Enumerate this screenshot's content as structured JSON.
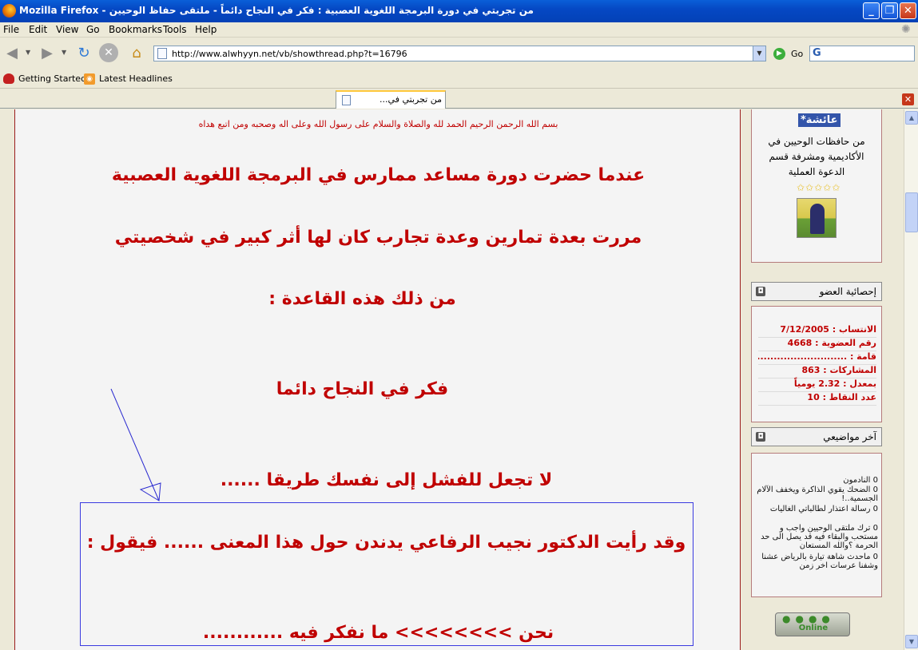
{
  "window": {
    "title": "من تجربتي في دورة البرمجة اللغوية العصبية : فكر في النجاح دائماً - ملتقى حفاظ الوحيين - Mozilla Firefox",
    "min_label": "_",
    "max_label": "❐",
    "close_label": "✕"
  },
  "menu": {
    "file": "File",
    "edit": "Edit",
    "view": "View",
    "go": "Go",
    "bookmarks": "Bookmarks",
    "tools": "Tools",
    "help": "Help"
  },
  "nav": {
    "back_icon": "◀",
    "forward_icon": "▶",
    "reload_icon": "↻",
    "stop_icon": "✕",
    "home_icon": "⌂",
    "url": "http://www.alwhyyn.net/vb/showthread.php?t=16796",
    "go_label": "Go",
    "search_icon": "G"
  },
  "bookmarks": {
    "item1": "Getting Started",
    "item2": "Latest Headlines"
  },
  "tabs": {
    "tab1_label": "من تجربتي في..."
  },
  "post": {
    "bismillah": "بسم الله الرحمن الرحيم الحمد لله والصلاة والسلام على رسول الله وعلى اله وصحبه ومن اتبع هداه",
    "line1": "عندما حضرت دورة مساعد ممارس في البرمجة اللغوية العصبية",
    "line2": "مررت بعدة تمارين وعدة تجارب كان لها أثر كبير في شخصيتي",
    "line3": "من ذلك هذه القاعدة :",
    "line4": "فكر في النجاح دائما",
    "line5": "لا تجعل للفشل إلى نفسك طريقا ......",
    "line6": "وقد رأيت الدكتور نجيب الرفاعي يدندن حول هذا المعنى ...... فيقول :",
    "line7": "نحن >>>>>>>> ما نفكر فيه ............"
  },
  "sidebar": {
    "username": "عائشة*",
    "user_title": "من حافظات الوحيين في الأكاديمية ومشرفة قسم الدعوة العملية",
    "stars": "✩✩✩✩✩",
    "stats_header": "إحصائية العضو",
    "stats": [
      "الانتساب : 7/12/2005",
      "رقم العضوية : 4668",
      "قامة : ....................................",
      "المشاركات : 863",
      "بمعدل : 2.32 يومياً",
      "عدد النقاط : 10"
    ],
    "topics_header": "آخر مواضيعي",
    "topics": [
      "0 النادمون",
      "0 الضحك يقوي الذاكرة ويخفف الآلام الجسمية..!",
      "0 رسالة اعتذار لطالباتي الغاليات",
      "0 ترك ملتقى الوحيين واجب و مستحب والبقاء فيه قد يصل الى حد الحرمة ؟والله المستعان",
      "0 ماحدث شاهة تيارة بالرياض عشنا وشفنا عرسات اخر زمن"
    ],
    "online_label": "Online"
  },
  "colors": {
    "post_text": "#c00000",
    "panel_border": "#b57b7b",
    "quote_border": "#3a3ae0"
  }
}
